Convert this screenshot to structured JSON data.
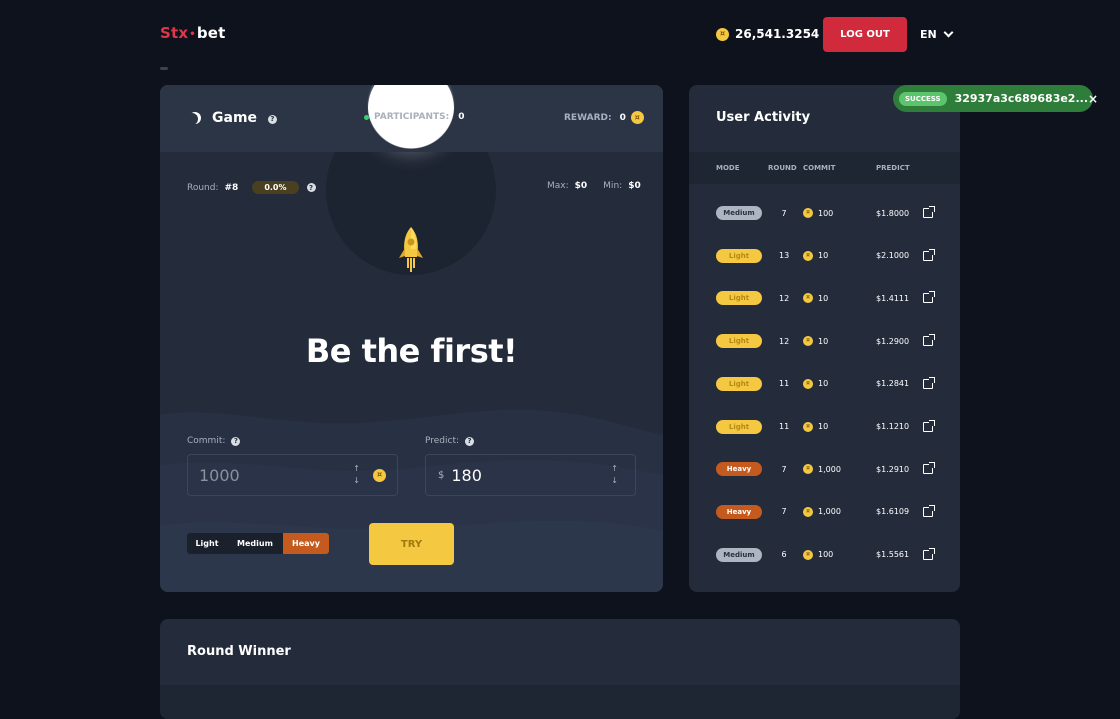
{
  "header": {
    "logo_part1": "Stx",
    "logo_dot": "•",
    "logo_part2": "bet",
    "balance": "26,541.3254",
    "logout_label": "LOG OUT",
    "language": "EN"
  },
  "game": {
    "title": "Game",
    "participants_label": "PARTICIPANTS:",
    "participants_value": "0",
    "reward_label": "REWARD:",
    "reward_value": "0",
    "round_label": "Round:",
    "round_value": "#8",
    "round_pct": "0.0%",
    "max_label": "Max:",
    "max_value": "$0",
    "min_label": "Min:",
    "min_value": "$0",
    "headline": "Be the first!",
    "commit_label": "Commit:",
    "commit_value": "1000",
    "predict_label": "Predict:",
    "predict_currency": "$",
    "predict_value": "180",
    "modes": [
      "Light",
      "Medium",
      "Heavy"
    ],
    "selected_mode": "Heavy",
    "try_label": "TRY"
  },
  "activity": {
    "title": "User Activity",
    "columns": [
      "MODE",
      "ROUND",
      "COMMIT",
      "PREDICT"
    ],
    "rows": [
      {
        "mode": "Medium",
        "round": "7",
        "commit": "100",
        "predict": "$1.8000"
      },
      {
        "mode": "Light",
        "round": "13",
        "commit": "10",
        "predict": "$2.1000"
      },
      {
        "mode": "Light",
        "round": "12",
        "commit": "10",
        "predict": "$1.4111"
      },
      {
        "mode": "Light",
        "round": "12",
        "commit": "10",
        "predict": "$1.2900"
      },
      {
        "mode": "Light",
        "round": "11",
        "commit": "10",
        "predict": "$1.2841"
      },
      {
        "mode": "Light",
        "round": "11",
        "commit": "10",
        "predict": "$1.1210"
      },
      {
        "mode": "Heavy",
        "round": "7",
        "commit": "1,000",
        "predict": "$1.2910"
      },
      {
        "mode": "Heavy",
        "round": "7",
        "commit": "1,000",
        "predict": "$1.6109"
      },
      {
        "mode": "Medium",
        "round": "6",
        "commit": "100",
        "predict": "$1.5561"
      }
    ]
  },
  "toast": {
    "badge": "SUCCESS",
    "text": "32937a3c689683e2...",
    "close": "×"
  },
  "winner": {
    "title": "Round Winner"
  },
  "icons": {
    "coin": "coin-icon",
    "moon": "moon-icon",
    "rocket": "rocket-icon",
    "external_link": "external-link-icon"
  },
  "colors": {
    "accent_red": "#d12a3d",
    "accent_yellow": "#f5c842",
    "heavy_orange": "#c55a1f",
    "success_green": "#2e7d3a"
  }
}
